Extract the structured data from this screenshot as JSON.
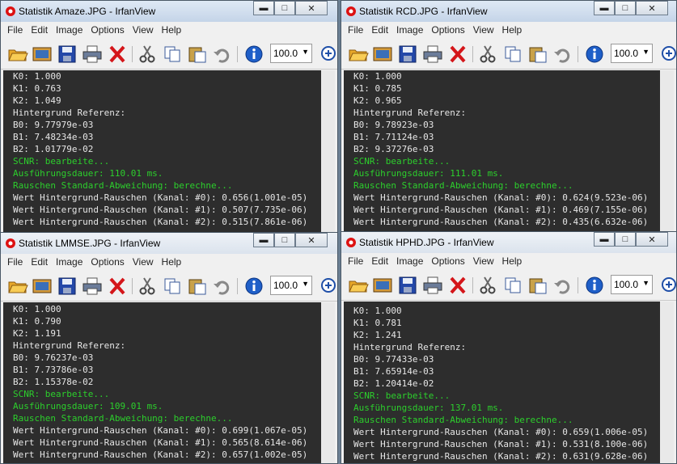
{
  "windows": [
    {
      "title": "Statistik Amaze.JPG - IrfanView",
      "zoom": "100.0",
      "lines": [
        {
          "t": "K0: 1.000",
          "c": "w"
        },
        {
          "t": "K1: 0.763",
          "c": "w"
        },
        {
          "t": "K2: 1.049",
          "c": "w"
        },
        {
          "t": "Hintergrund Referenz:",
          "c": "w"
        },
        {
          "t": "B0: 9.77979e-03",
          "c": "w"
        },
        {
          "t": "B1: 7.48234e-03",
          "c": "w"
        },
        {
          "t": "B2: 1.01779e-02",
          "c": "w"
        },
        {
          "t": "SCNR: bearbeite...",
          "c": "g"
        },
        {
          "t": "Ausführungsdauer: 110.01 ms.",
          "c": "g"
        },
        {
          "t": "Rauschen Standard-Abweichung: berechne...",
          "c": "g"
        },
        {
          "t": "Wert Hintergrund-Rauschen (Kanal: #0): 0.656(1.001e-05)",
          "c": "w"
        },
        {
          "t": "Wert Hintergrund-Rauschen (Kanal: #1): 0.507(7.735e-06)",
          "c": "w"
        },
        {
          "t": "Wert Hintergrund-Rauschen (Kanal: #2): 0.515(7.861e-06)",
          "c": "w"
        }
      ]
    },
    {
      "title": "Statistik RCD.JPG - IrfanView",
      "zoom": "100.0",
      "lines": [
        {
          "t": "K0: 1.000",
          "c": "w"
        },
        {
          "t": "K1: 0.785",
          "c": "w"
        },
        {
          "t": "K2: 0.965",
          "c": "w"
        },
        {
          "t": "Hintergrund Referenz:",
          "c": "w"
        },
        {
          "t": "B0: 9.78923e-03",
          "c": "w"
        },
        {
          "t": "B1: 7.71124e-03",
          "c": "w"
        },
        {
          "t": "B2: 9.37276e-03",
          "c": "w"
        },
        {
          "t": "SCNR: bearbeite...",
          "c": "g"
        },
        {
          "t": "Ausführungsdauer: 111.01 ms.",
          "c": "g"
        },
        {
          "t": "Rauschen Standard-Abweichung: berechne...",
          "c": "g"
        },
        {
          "t": "Wert Hintergrund-Rauschen (Kanal: #0): 0.624(9.523e-06)",
          "c": "w"
        },
        {
          "t": "Wert Hintergrund-Rauschen (Kanal: #1): 0.469(7.155e-06)",
          "c": "w"
        },
        {
          "t": "Wert Hintergrund-Rauschen (Kanal: #2): 0.435(6.632e-06)",
          "c": "w"
        }
      ]
    },
    {
      "title": "Statistik LMMSE.JPG - IrfanView",
      "zoom": "100.0",
      "lines": [
        {
          "t": "K0: 1.000",
          "c": "w"
        },
        {
          "t": "K1: 0.790",
          "c": "w"
        },
        {
          "t": "K2: 1.191",
          "c": "w"
        },
        {
          "t": "Hintergrund Referenz:",
          "c": "w"
        },
        {
          "t": "B0: 9.76237e-03",
          "c": "w"
        },
        {
          "t": "B1: 7.73786e-03",
          "c": "w"
        },
        {
          "t": "B2: 1.15378e-02",
          "c": "w"
        },
        {
          "t": "SCNR: bearbeite...",
          "c": "g"
        },
        {
          "t": "Ausführungsdauer: 109.01 ms.",
          "c": "g"
        },
        {
          "t": "Rauschen Standard-Abweichung: berechne...",
          "c": "g"
        },
        {
          "t": "Wert Hintergrund-Rauschen (Kanal: #0): 0.699(1.067e-05)",
          "c": "w"
        },
        {
          "t": "Wert Hintergrund-Rauschen (Kanal: #1): 0.565(8.614e-06)",
          "c": "w"
        },
        {
          "t": "Wert Hintergrund-Rauschen (Kanal: #2): 0.657(1.002e-05)",
          "c": "w"
        }
      ]
    },
    {
      "title": "Statistik HPHD.JPG - IrfanView",
      "zoom": "100.0",
      "lines": [
        {
          "t": "K0: 1.000",
          "c": "w"
        },
        {
          "t": "K1: 0.781",
          "c": "w"
        },
        {
          "t": "K2: 1.241",
          "c": "w"
        },
        {
          "t": "Hintergrund Referenz:",
          "c": "w"
        },
        {
          "t": "B0: 9.77433e-03",
          "c": "w"
        },
        {
          "t": "B1: 7.65914e-03",
          "c": "w"
        },
        {
          "t": "B2: 1.20414e-02",
          "c": "w"
        },
        {
          "t": "SCNR: bearbeite...",
          "c": "g"
        },
        {
          "t": "Ausführungsdauer: 137.01 ms.",
          "c": "g"
        },
        {
          "t": "Rauschen Standard-Abweichung: berechne...",
          "c": "g"
        },
        {
          "t": "Wert Hintergrund-Rauschen (Kanal: #0): 0.659(1.006e-05)",
          "c": "w"
        },
        {
          "t": "Wert Hintergrund-Rauschen (Kanal: #1): 0.531(8.100e-06)",
          "c": "w"
        },
        {
          "t": "Wert Hintergrund-Rauschen (Kanal: #2): 0.631(9.628e-06)",
          "c": "w"
        }
      ]
    }
  ],
  "menu": [
    "File",
    "Edit",
    "Image",
    "Options",
    "View",
    "Help"
  ],
  "colors": {
    "output_bg": "#2d2d2d",
    "text_white": "#e6e6e6",
    "text_green": "#2ccf2c"
  }
}
